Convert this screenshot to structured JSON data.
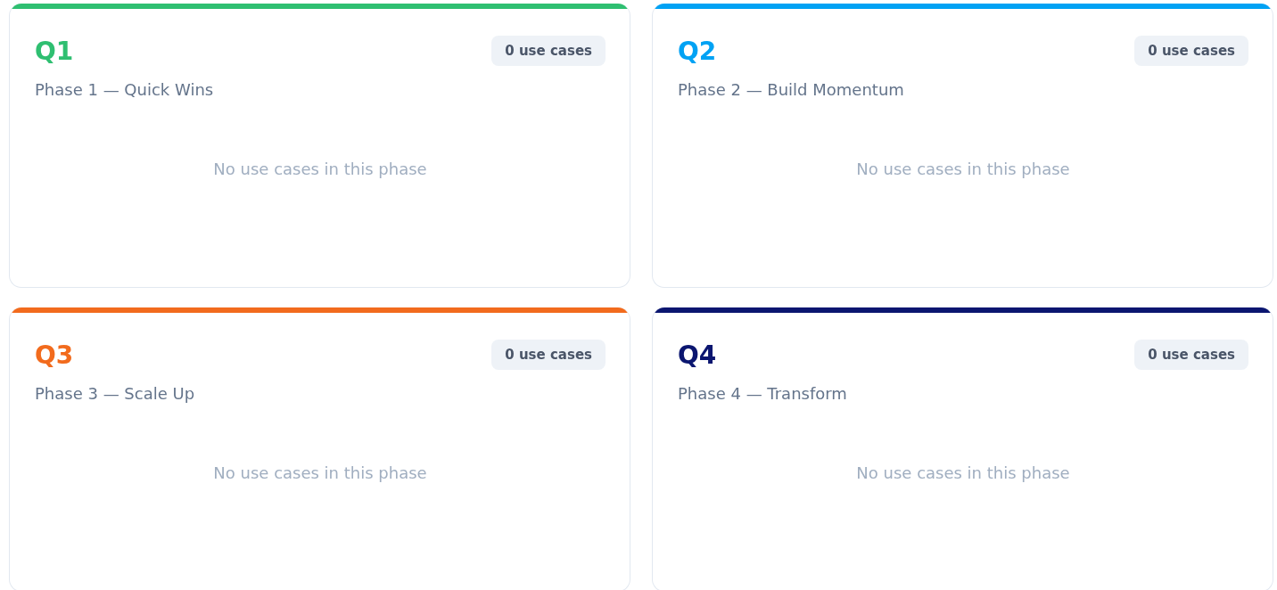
{
  "phases": [
    {
      "quarter": "Q1",
      "title": "Phase 1 — Quick Wins",
      "count": "0 use cases",
      "empty": "No use cases in this phase",
      "color": "#2fbf71"
    },
    {
      "quarter": "Q2",
      "title": "Phase 2 — Build Momentum",
      "count": "0 use cases",
      "empty": "No use cases in this phase",
      "color": "#00a2f4"
    },
    {
      "quarter": "Q3",
      "title": "Phase 3 — Scale Up",
      "count": "0 use cases",
      "empty": "No use cases in this phase",
      "color": "#f26b1d"
    },
    {
      "quarter": "Q4",
      "title": "Phase 4 — Transform",
      "count": "0 use cases",
      "empty": "No use cases in this phase",
      "color": "#0b1670"
    }
  ]
}
